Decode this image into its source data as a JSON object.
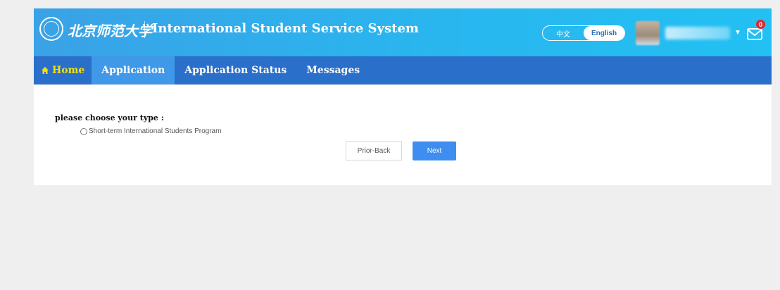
{
  "header": {
    "logo_text": "北京师范大学",
    "title": "International Student Service System",
    "lang_options": [
      "中文",
      "English"
    ],
    "active_lang": "English",
    "mail_badge_count": "0"
  },
  "nav": {
    "items": [
      {
        "label": "Home"
      },
      {
        "label": "Application"
      },
      {
        "label": "Application Status"
      },
      {
        "label": "Messages"
      }
    ],
    "active": "Application"
  },
  "main": {
    "prompt": "please choose your type :",
    "option_label": "Short-term International Students Program",
    "back_label": "Prior-Back",
    "next_label": "Next"
  },
  "colors": {
    "header_blue": "#29b6ef",
    "nav_blue": "#2a6fca",
    "nav_active": "#3f98e8",
    "home_yellow": "#f5e100",
    "next_button": "#3d8ef0",
    "badge_red": "#e0282e"
  }
}
